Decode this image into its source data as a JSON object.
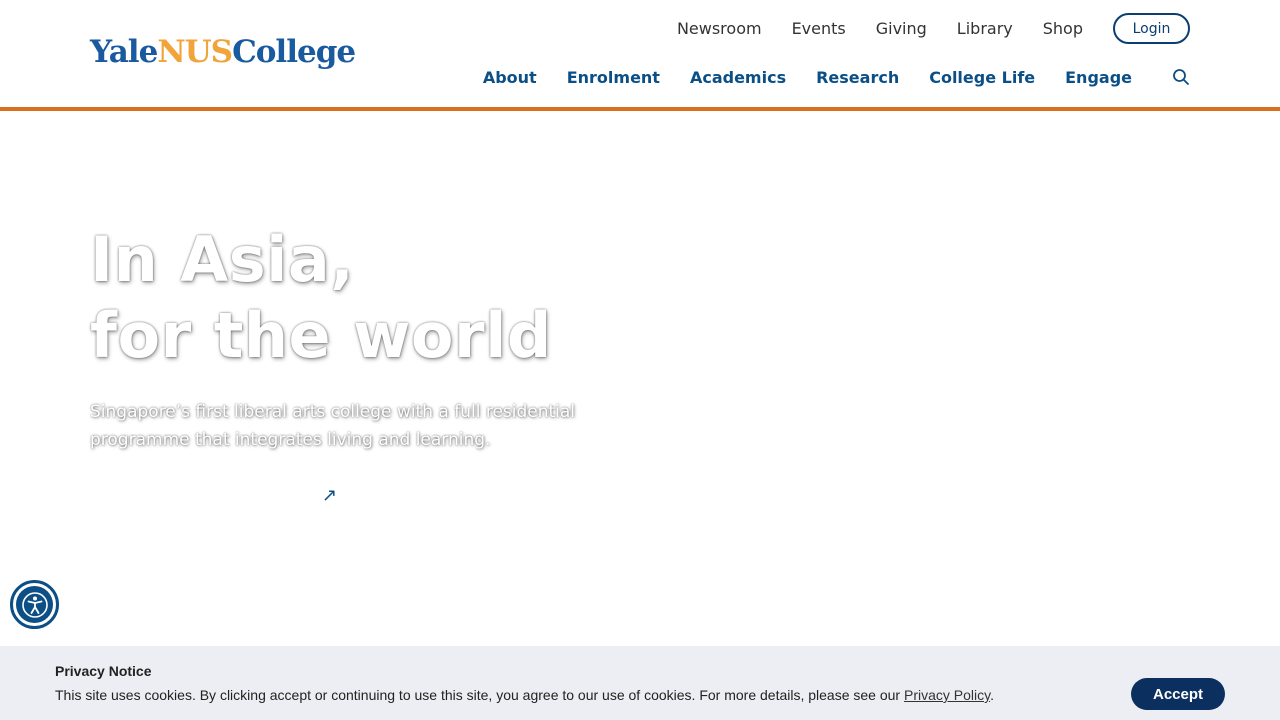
{
  "header": {
    "logo": {
      "part_a": "Yale",
      "part_b": "NUS",
      "part_c": "College"
    },
    "utility_nav": [
      "Newsroom",
      "Events",
      "Giving",
      "Library",
      "Shop"
    ],
    "login_label": "Login",
    "main_nav": [
      "About",
      "Enrolment",
      "Academics",
      "Research",
      "College Life",
      "Engage"
    ],
    "search_icon": "search-icon"
  },
  "hero": {
    "title_line1": "In Asia,",
    "title_line2": "for the world",
    "subtitle": "Singapore’s first liberal arts college with a full residential programme that integrates living and learning.",
    "link_icon": "↗"
  },
  "accessibility": {
    "icon": "accessibility-icon"
  },
  "privacy": {
    "title": "Privacy Notice",
    "text": "This site uses cookies. By clicking accept or continuing to use this site, you agree to our use of cookies. For more details, please see our ",
    "link_label": "Privacy Policy",
    "text_end": ".",
    "accept_label": "Accept"
  },
  "colors": {
    "brand_blue": "#0b4f86",
    "brand_orange": "#d8711f",
    "logo_gold": "#f0a43a",
    "accept_navy": "#0b3060"
  }
}
